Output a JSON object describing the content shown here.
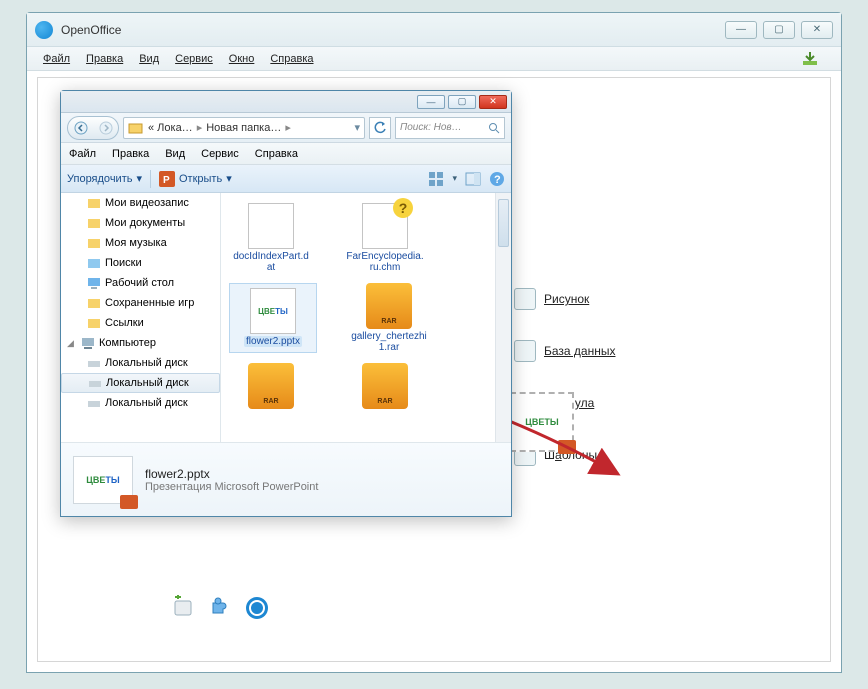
{
  "openoffice": {
    "title": "OpenOffice",
    "menu": {
      "file": "Файл",
      "edit": "Правка",
      "view": "Вид",
      "service": "Сервис",
      "window": "Окно",
      "help": "Справка"
    },
    "start_center": {
      "drawing": "Рисунок",
      "database": "База данных",
      "formula": "Формула",
      "templates": "Шаблоны…"
    }
  },
  "explorer": {
    "nav": {
      "crumb1": "« Лока…",
      "crumb2": "Новая папка…"
    },
    "search_placeholder": "Поиск: Нов…",
    "menu": {
      "file": "Файл",
      "edit": "Правка",
      "view": "Вид",
      "service": "Сервис",
      "help": "Справка"
    },
    "toolbar": {
      "organize": "Упорядочить",
      "open": "Открыть"
    },
    "tree": [
      {
        "label": "Мои видеозапис"
      },
      {
        "label": "Мои документы"
      },
      {
        "label": "Моя музыка"
      },
      {
        "label": "Поиски"
      },
      {
        "label": "Рабочий стол"
      },
      {
        "label": "Сохраненные игр"
      },
      {
        "label": "Ссылки"
      },
      {
        "label": "Компьютер"
      },
      {
        "label": "Локальный диск"
      },
      {
        "label": "Локальный диск"
      },
      {
        "label": "Локальный диск"
      }
    ],
    "files": [
      {
        "name": "docIdIndexPart.dat",
        "kind": "page"
      },
      {
        "name": "FarEncyclopedia.ru.chm",
        "kind": "chm"
      },
      {
        "name": "flower2.pptx",
        "kind": "pptx",
        "selected": true
      },
      {
        "name": "gallery_chertezhi 1.rar",
        "kind": "rar"
      },
      {
        "name": "",
        "kind": "rar"
      },
      {
        "name": "",
        "kind": "rar"
      }
    ],
    "details": {
      "name": "flower2.pptx",
      "type": "Презентация Microsoft PowerPoint"
    }
  },
  "drag": {
    "ghost_label": "ЦВЕТЫ"
  }
}
